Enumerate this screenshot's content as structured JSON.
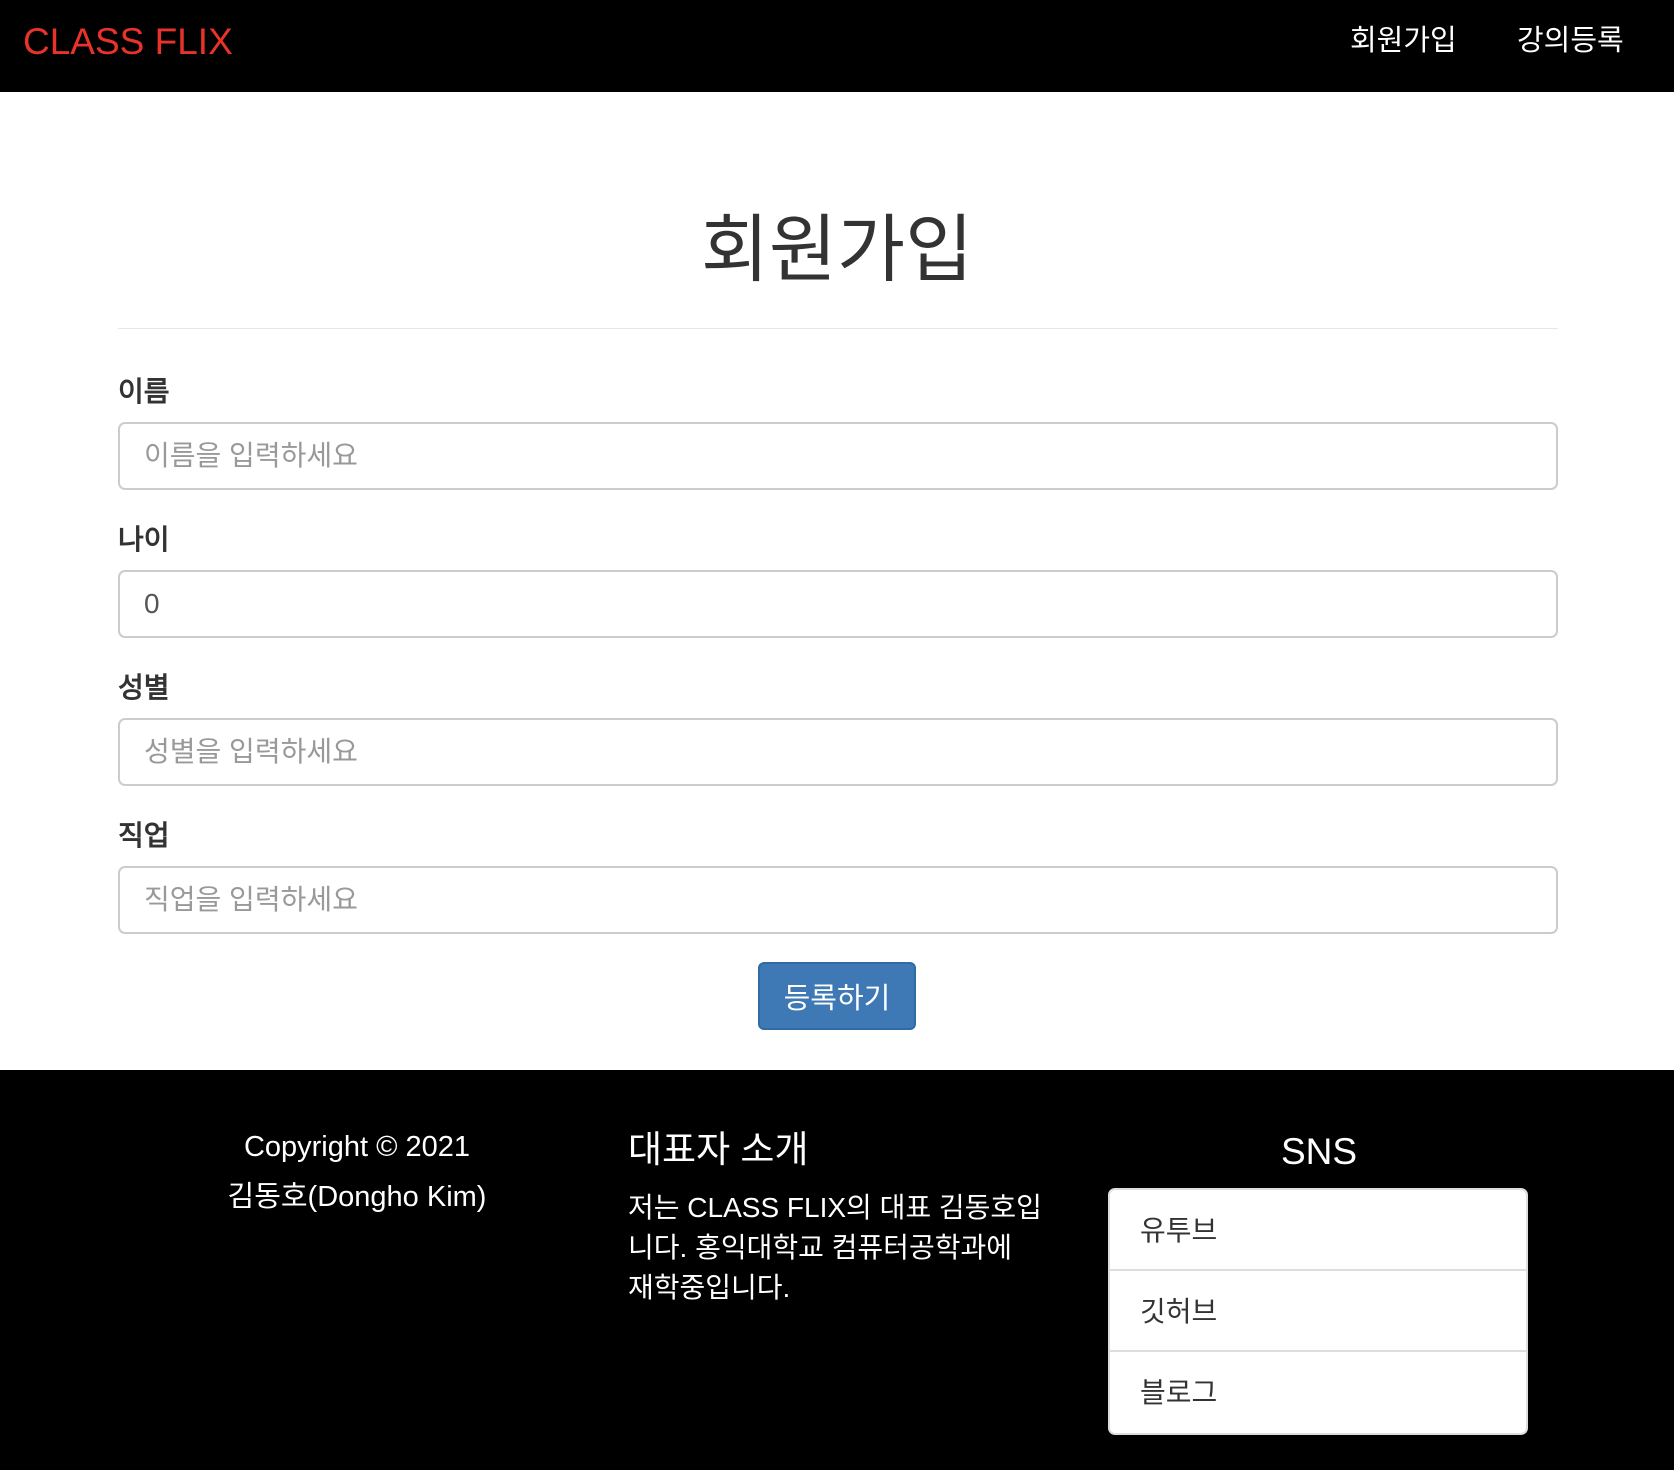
{
  "navbar": {
    "brand": "CLASS FLIX",
    "links": [
      {
        "label": "회원가입"
      },
      {
        "label": "강의등록"
      }
    ]
  },
  "main": {
    "title": "회원가입",
    "fields": {
      "name": {
        "label": "이름",
        "placeholder": "이름을 입력하세요",
        "value": ""
      },
      "age": {
        "label": "나이",
        "placeholder": "",
        "value": "0"
      },
      "gender": {
        "label": "성별",
        "placeholder": "성별을 입력하세요",
        "value": ""
      },
      "job": {
        "label": "직업",
        "placeholder": "직업을 입력하세요",
        "value": ""
      }
    },
    "submit_label": "등록하기"
  },
  "footer": {
    "copyright_line1": "Copyright © 2021",
    "copyright_line2": "김동호(Dongho Kim)",
    "about_title": "대표자 소개",
    "about_text": "저는 CLASS FLIX의 대표 김동호입니다. 홍익대학교 컴퓨터공학과에 재학중입니다.",
    "sns_title": "SNS",
    "sns_items": [
      {
        "label": "유투브"
      },
      {
        "label": "깃허브"
      },
      {
        "label": "블로그"
      }
    ]
  },
  "colors": {
    "brand": "#e8322a",
    "primary_button": "#3e78b5",
    "navbar_bg": "#000000",
    "footer_bg": "#000000"
  }
}
